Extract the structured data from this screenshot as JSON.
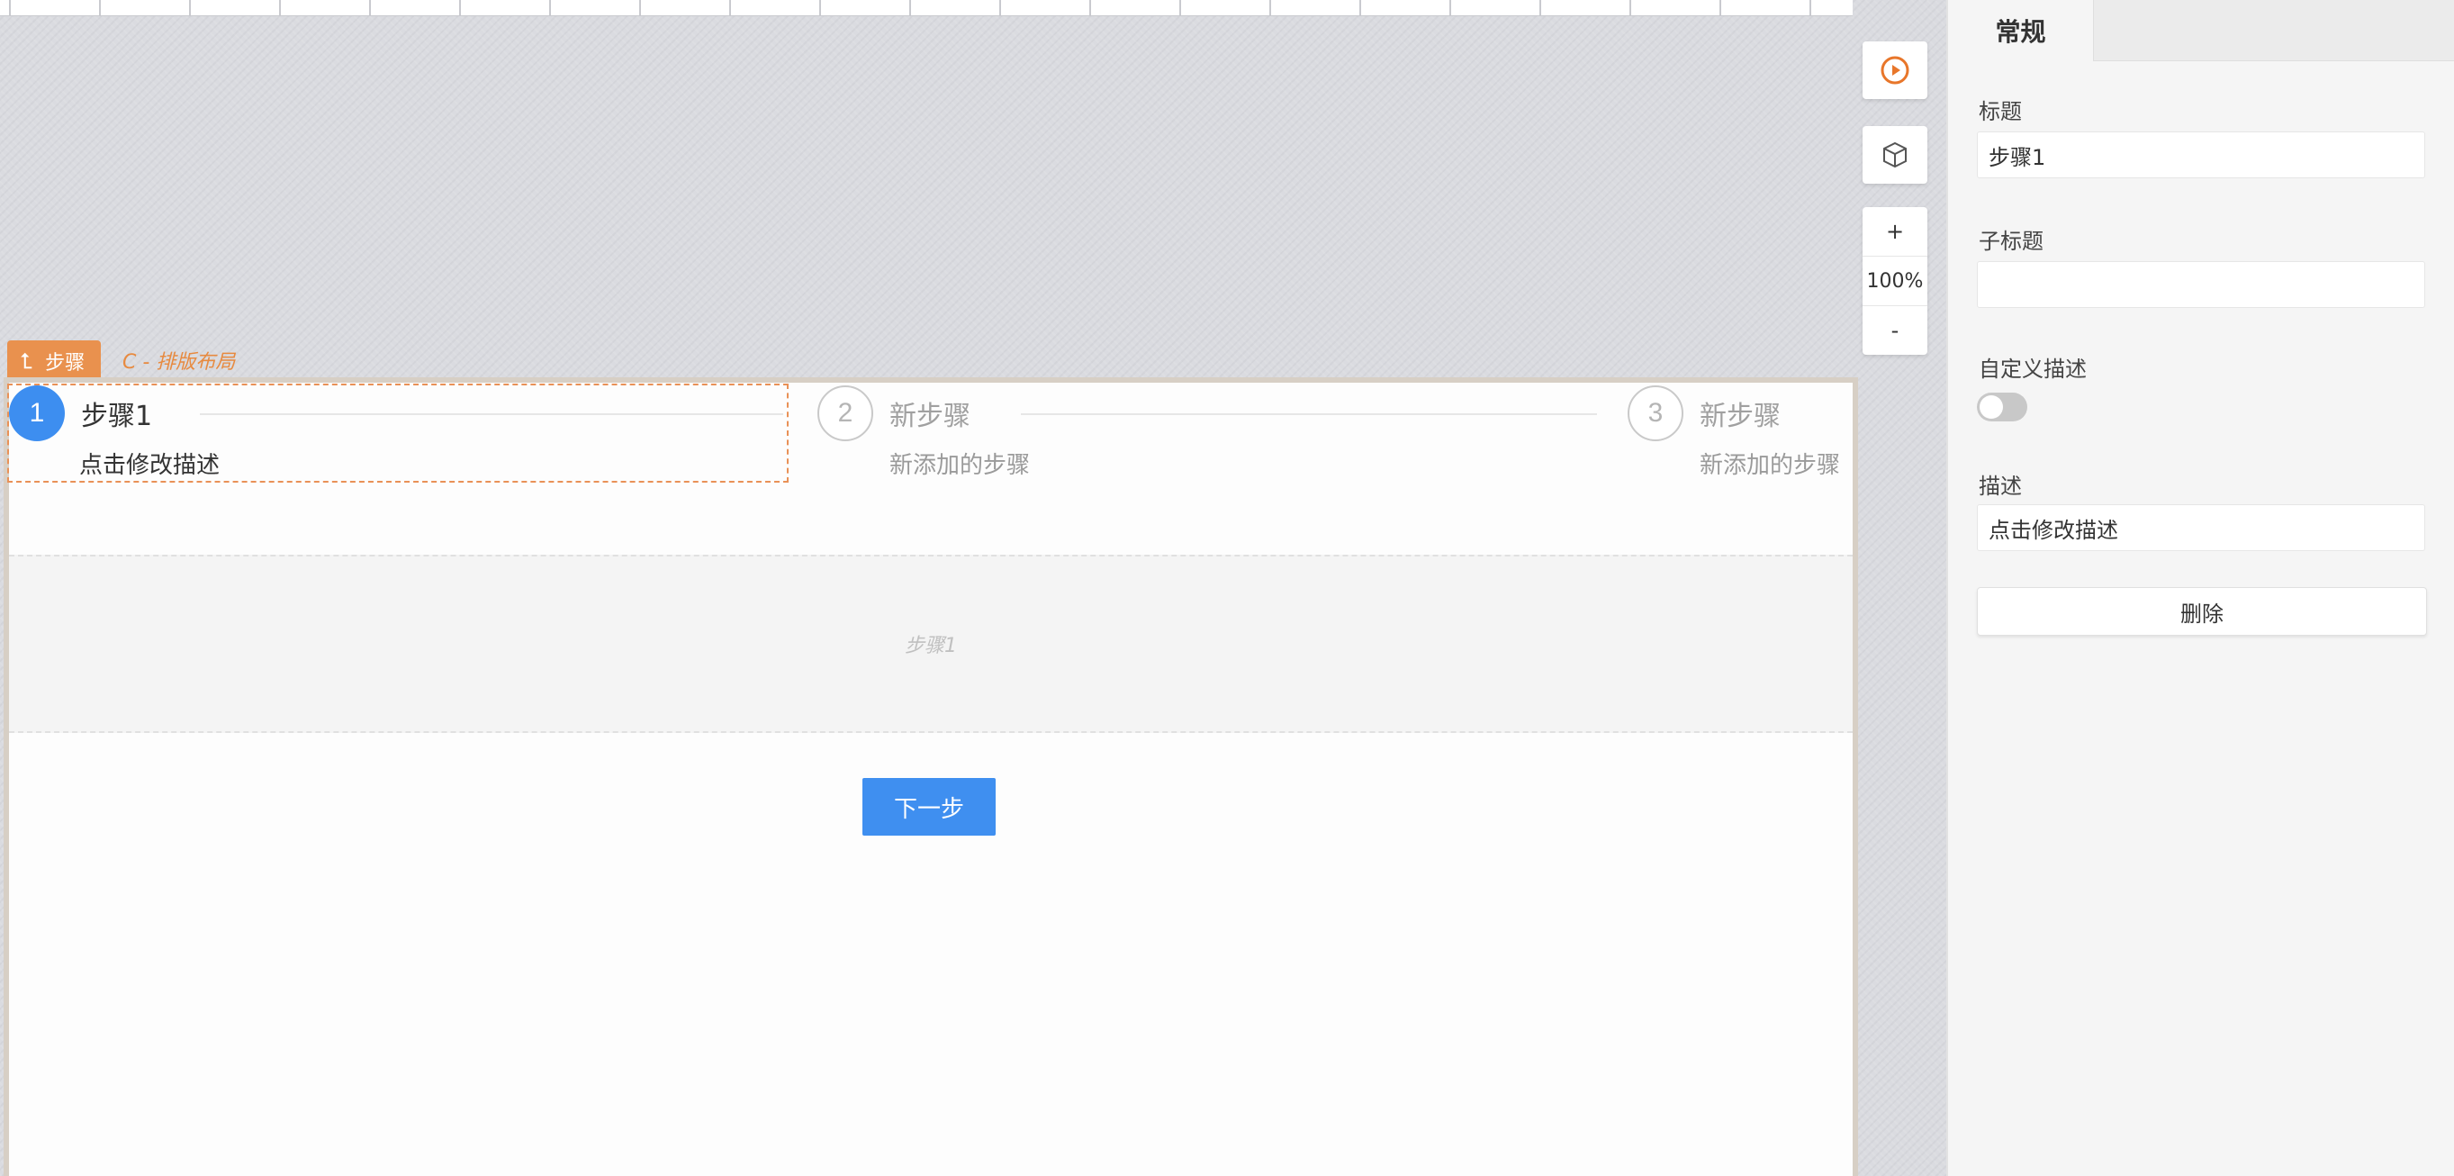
{
  "canvas": {
    "breadcrumb": {
      "label": "步骤",
      "path": "C - 排版布局"
    },
    "steps": [
      {
        "number": "1",
        "title": "步骤1",
        "description": "点击修改描述",
        "state": "active"
      },
      {
        "number": "2",
        "title": "新步骤",
        "description": "新添加的步骤",
        "state": "idle"
      },
      {
        "number": "3",
        "title": "新步骤",
        "description": "新添加的步骤",
        "state": "idle"
      }
    ],
    "content_placeholder": "步骤1",
    "next_button_label": "下一步"
  },
  "tools": {
    "preview_icon": "play-circle-icon",
    "component_icon": "cube-icon",
    "zoom_in_label": "+",
    "zoom_level": "100%",
    "zoom_out_label": "-"
  },
  "panel": {
    "tab": "常规",
    "title_label": "标题",
    "title_value": "步骤1",
    "subtitle_label": "子标题",
    "subtitle_value": "",
    "custom_desc_label": "自定义描述",
    "custom_desc_enabled": false,
    "desc_label": "描述",
    "desc_value": "点击修改描述",
    "delete_label": "删除"
  },
  "colors": {
    "accent": "#3f8ff0",
    "selection": "#e9914e",
    "preview_icon": "#e8762a"
  }
}
